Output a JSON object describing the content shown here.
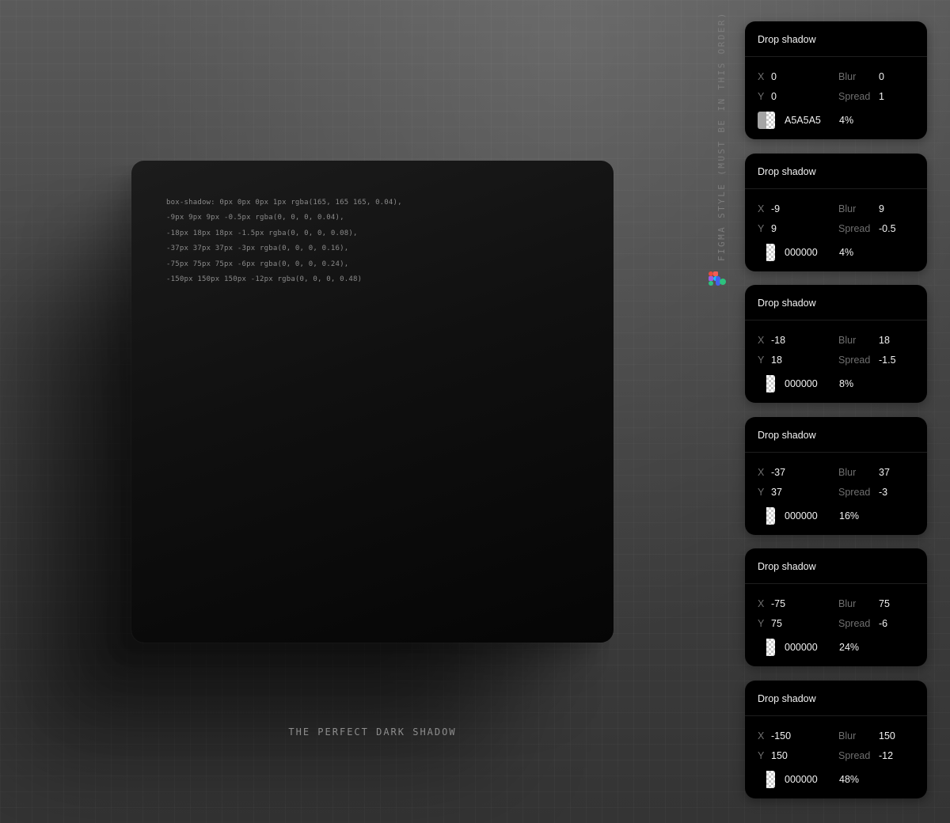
{
  "code": {
    "lines": [
      "box-shadow: 0px 0px 0px 1px rgba(165, 165 165, 0.04),",
      "-9px 9px 9px -0.5px rgba(0, 0, 0, 0.04),",
      "-18px 18px 18px -1.5px rgba(0, 0, 0, 0.08),",
      "-37px 37px 37px -3px rgba(0, 0, 0, 0.16),",
      "-75px 75px 75px -6px rgba(0, 0, 0, 0.24),",
      "-150px 150px 150px -12px rgba(0, 0, 0, 0.48)"
    ]
  },
  "caption": "THE PERFECT DARK SHADOW",
  "vertical_label": "FIGMA STYLE (MUST BE IN THIS ORDER)",
  "figma_icon": "figma-logo-icon",
  "labels": {
    "x": "X",
    "y": "Y",
    "blur": "Blur",
    "spread": "Spread"
  },
  "panels": [
    {
      "title": "Drop shadow",
      "x": "0",
      "y": "0",
      "blur": "0",
      "spread": "1",
      "color": "A5A5A5",
      "opacity": "4%",
      "swatch_color": "#a5a5a5"
    },
    {
      "title": "Drop shadow",
      "x": "-9",
      "y": "9",
      "blur": "9",
      "spread": "-0.5",
      "color": "000000",
      "opacity": "4%",
      "swatch_color": "#000000"
    },
    {
      "title": "Drop shadow",
      "x": "-18",
      "y": "18",
      "blur": "18",
      "spread": "-1.5",
      "color": "000000",
      "opacity": "8%",
      "swatch_color": "#000000"
    },
    {
      "title": "Drop shadow",
      "x": "-37",
      "y": "37",
      "blur": "37",
      "spread": "-3",
      "color": "000000",
      "opacity": "16%",
      "swatch_color": "#000000"
    },
    {
      "title": "Drop shadow",
      "x": "-75",
      "y": "75",
      "blur": "75",
      "spread": "-6",
      "color": "000000",
      "opacity": "24%",
      "swatch_color": "#000000"
    },
    {
      "title": "Drop shadow",
      "x": "-150",
      "y": "150",
      "blur": "150",
      "spread": "-12",
      "color": "000000",
      "opacity": "48%",
      "swatch_color": "#000000"
    }
  ]
}
